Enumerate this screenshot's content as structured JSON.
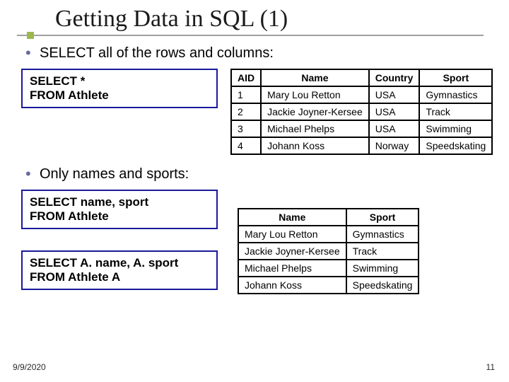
{
  "title": "Getting Data in SQL (1)",
  "bullets": {
    "b1": "SELECT all of the rows and columns:",
    "b2": "Only names and sports:"
  },
  "code": {
    "q1": "SELECT *\nFROM Athlete",
    "q2": "SELECT name, sport\nFROM Athlete",
    "q3": "SELECT A. name, A. sport\nFROM Athlete A"
  },
  "table1": {
    "headers": {
      "aid": "AID",
      "name": "Name",
      "country": "Country",
      "sport": "Sport"
    },
    "rows": [
      {
        "aid": "1",
        "name": "Mary Lou Retton",
        "country": "USA",
        "sport": "Gymnastics"
      },
      {
        "aid": "2",
        "name": "Jackie Joyner-Kersee",
        "country": "USA",
        "sport": "Track"
      },
      {
        "aid": "3",
        "name": "Michael Phelps",
        "country": "USA",
        "sport": "Swimming"
      },
      {
        "aid": "4",
        "name": "Johann Koss",
        "country": "Norway",
        "sport": "Speedskating"
      }
    ]
  },
  "table2": {
    "headers": {
      "name": "Name",
      "sport": "Sport"
    },
    "rows": [
      {
        "name": "Mary Lou Retton",
        "sport": "Gymnastics"
      },
      {
        "name": "Jackie Joyner-Kersee",
        "sport": "Track"
      },
      {
        "name": "Michael Phelps",
        "sport": "Swimming"
      },
      {
        "name": "Johann Koss",
        "sport": "Speedskating"
      }
    ]
  },
  "footer": {
    "date": "9/9/2020",
    "page": "11"
  }
}
